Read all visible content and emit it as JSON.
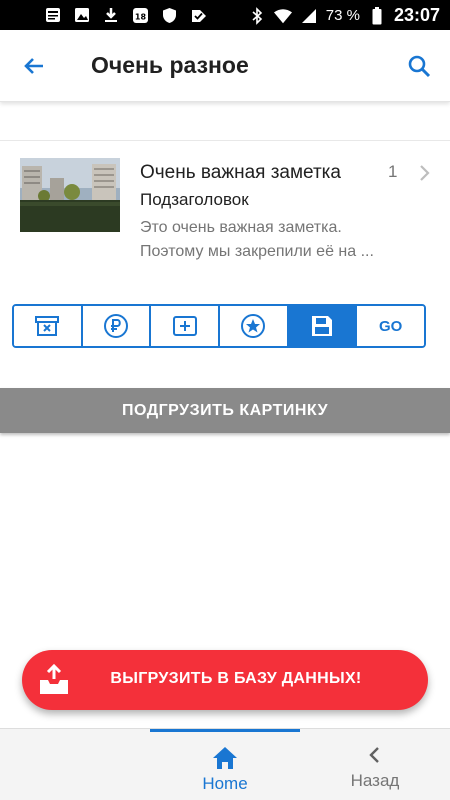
{
  "status_bar": {
    "battery": "73 %",
    "time": "23:07",
    "icons": [
      "news-icon",
      "image-icon",
      "download-icon",
      "calendar-18-icon",
      "shield-icon",
      "check-tag-icon",
      "bluetooth-icon",
      "wifi-icon",
      "signal-icon",
      "battery-icon"
    ]
  },
  "toolbar": {
    "title": "Очень разное",
    "back_icon": "arrow-left-icon",
    "search_icon": "search-icon"
  },
  "note": {
    "title": "Очень важная заметка",
    "count": "1",
    "subtitle": "Подзаголовок",
    "body_line1": "Это очень важная заметка.",
    "body_line2": "Поэтому мы закрепили её на ..."
  },
  "segments": {
    "items": [
      "archive-delete-icon",
      "ruble-icon",
      "add-box-icon",
      "star-circle-icon",
      "save-icon",
      "go-text"
    ],
    "active_index": 4,
    "go_label": "GO"
  },
  "load_button": {
    "label": "ПОДГРУЗИТЬ КАРТИНКУ"
  },
  "fab": {
    "label": "ВЫГРУЗИТЬ В БАЗУ ДАННЫХ!",
    "icon": "upload-tray-icon"
  },
  "bottom_nav": {
    "home_label": "Home",
    "back_label": "Назад",
    "active": "home"
  },
  "colors": {
    "accent": "#1976d2",
    "fab": "#f4303a",
    "load_button": "#8a8a8a"
  }
}
